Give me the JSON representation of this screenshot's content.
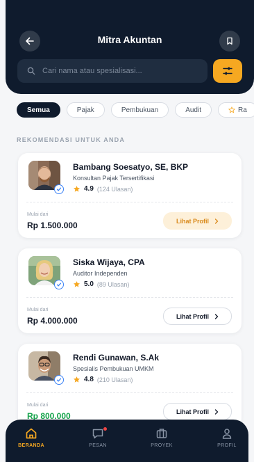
{
  "header": {
    "title": "Mitra Akuntan",
    "back_icon": "arrow-left-icon",
    "bookmark_icon": "bookmark-icon",
    "search_placeholder": "Cari nama atau spesialisasi...",
    "filter_icon": "sliders-icon"
  },
  "filters": [
    "Semua",
    "Pajak",
    "Pembukuan",
    "Audit",
    "Ra"
  ],
  "active_filter": "Semua",
  "section_title": "REKOMENDASI UNTUK ANDA",
  "accountants": [
    {
      "name": "Bambang Soesatyo, SE, BKP",
      "role": "Konsultan Pajak Tersertifikasi",
      "rating": "4.9",
      "reviews": "(124 Ulasan)",
      "price_label": "Mulai dari",
      "price": "Rp 1.500.000",
      "button": "Lihat Profil"
    },
    {
      "name": "Siska Wijaya, CPA",
      "role": "Auditor Independen",
      "rating": "5.0",
      "reviews": "(89 Ulasan)",
      "price_label": "Mulai dari",
      "price": "Rp 4.000.000",
      "button": "Lihat Profil"
    },
    {
      "name": "Rendi Gunawan, S.Ak",
      "role": "Spesialis Pembukuan UMKM",
      "rating": "4.8",
      "reviews": "(210 Ulasan)",
      "price_label": "Mulai dari",
      "price": "Rp 800.000",
      "button": "Lihat Profil"
    }
  ],
  "nav": [
    {
      "label": "BERANDA",
      "icon": "home-icon"
    },
    {
      "label": "PESAN",
      "icon": "message-icon"
    },
    {
      "label": "PROYEK",
      "icon": "briefcase-icon"
    },
    {
      "label": "PROFIL",
      "icon": "user-icon"
    }
  ],
  "colors": {
    "primary_dark": "#0f1b2d",
    "accent": "#f6a821",
    "price_green": "#14a34a",
    "verified_blue": "#3b82f6",
    "notification": "#ef4444"
  }
}
